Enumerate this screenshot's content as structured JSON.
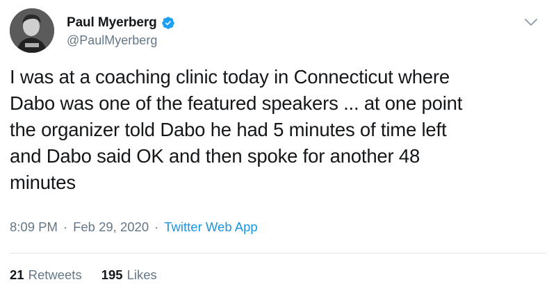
{
  "user": {
    "display_name": "Paul Myerberg",
    "handle": "@PaulMyerberg",
    "verified": true
  },
  "tweet": {
    "text": "I was at a coaching clinic today in Connecticut where\nDabo was one of the featured speakers ... at one point\nthe organizer told Dabo he had 5 minutes of time left\nand Dabo said OK and then spoke for another 48\nminutes",
    "time": "8:09 PM",
    "separator": "·",
    "date": "Feb 29, 2020",
    "source": "Twitter Web App"
  },
  "stats": {
    "retweets_count": "21",
    "retweets_label": "Retweets",
    "likes_count": "195",
    "likes_label": "Likes"
  },
  "colors": {
    "accent": "#1b95e0",
    "secondary_text": "#657786",
    "primary_text": "#14171a",
    "divider": "#e1e8ed"
  },
  "icons": {
    "verified": "verified-badge-icon",
    "menu": "chevron-down-icon"
  }
}
